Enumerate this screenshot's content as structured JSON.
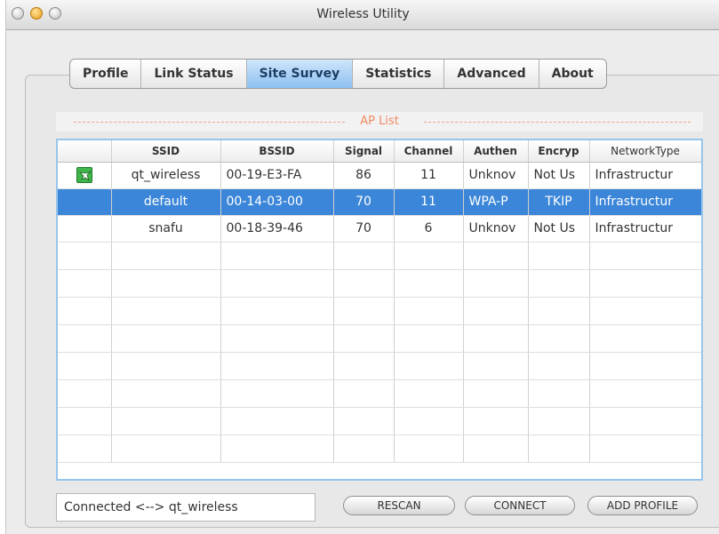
{
  "window": {
    "title": "Wireless Utility"
  },
  "tabs": [
    {
      "label": "Profile"
    },
    {
      "label": "Link Status"
    },
    {
      "label": "Site Survey",
      "active": true
    },
    {
      "label": "Statistics"
    },
    {
      "label": "Advanced"
    },
    {
      "label": "About"
    }
  ],
  "ap_list": {
    "title": "AP List",
    "columns": [
      "",
      "SSID",
      "BSSID",
      "Signal",
      "Channel",
      "Authen",
      "Encryp",
      "NetworkType"
    ],
    "rows": [
      {
        "icon": "connected-icon",
        "ssid": "qt_wireless",
        "bssid": "00-19-E3-FA",
        "signal": "86",
        "channel": "11",
        "authen": "Unknov",
        "encryp": "Not Us",
        "network_type": "Infrastructur",
        "selected": false
      },
      {
        "icon": "",
        "ssid": "default",
        "bssid": "00-14-03-00",
        "signal": "70",
        "channel": "11",
        "authen": "WPA-P",
        "encryp": "TKIP",
        "network_type": "Infrastructur",
        "selected": true
      },
      {
        "icon": "",
        "ssid": "snafu",
        "bssid": "00-18-39-46",
        "signal": "70",
        "channel": "6",
        "authen": "Unknov",
        "encryp": "Not Us",
        "network_type": "Infrastructur",
        "selected": false
      }
    ],
    "empty_rows": 8
  },
  "status": {
    "text": "Connected <--> qt_wireless"
  },
  "buttons": {
    "rescan": "RESCAN",
    "connect": "CONNECT",
    "add_profile": "ADD PROFILE"
  },
  "colors": {
    "selection": "#3b86d8",
    "active_tab": "#8dc0f1",
    "ap_list_title": "#f08a62",
    "connected_icon": "#3fb54a"
  }
}
